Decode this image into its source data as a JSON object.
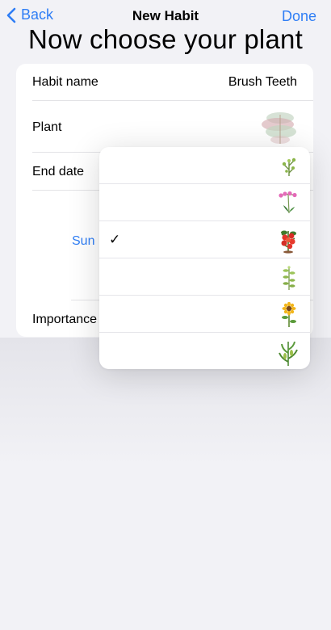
{
  "nav": {
    "back_label": "Back",
    "title": "New Habit",
    "done_label": "Done"
  },
  "headline": "Now choose your plant",
  "form": {
    "habit_name_label": "Habit name",
    "habit_name_value": "Brush Teeth",
    "plant_label": "Plant",
    "end_date_label": "End date",
    "day_label": "Sun",
    "importance_label": "Importance"
  },
  "plant_menu": {
    "options": [
      {
        "plant": "sprout-plant-icon",
        "selected": false
      },
      {
        "plant": "pink-orchid-plant-icon",
        "selected": false
      },
      {
        "plant": "tomato-plant-icon",
        "selected": true
      },
      {
        "plant": "tall-sprout-plant-icon",
        "selected": false
      },
      {
        "plant": "sunflower-plant-icon",
        "selected": false
      },
      {
        "plant": "corn-plant-icon",
        "selected": false
      }
    ],
    "checkmark": "✓"
  },
  "colors": {
    "accent": "#2f7ef5",
    "background": "#f2f2f6",
    "card": "#ffffff"
  }
}
